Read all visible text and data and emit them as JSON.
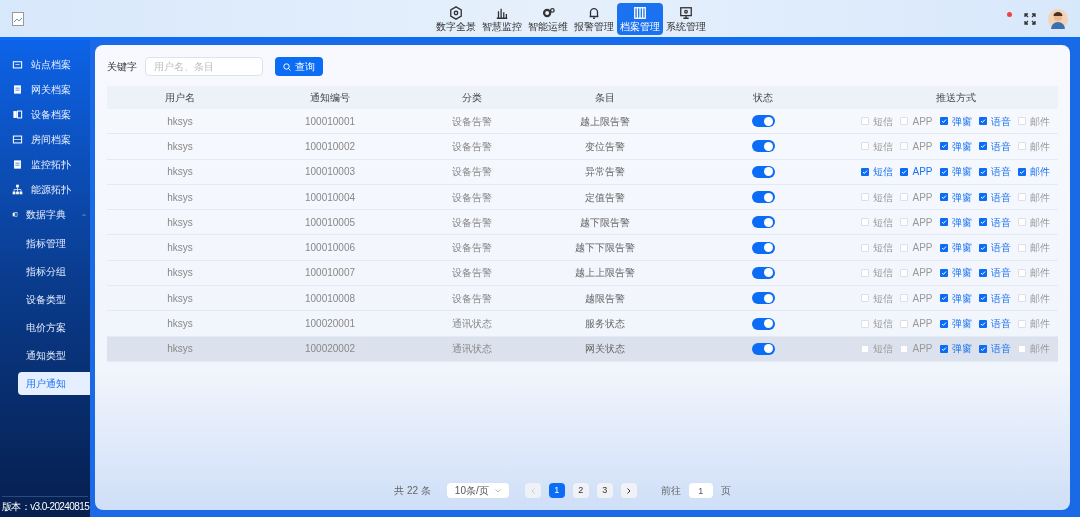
{
  "header": {
    "nav": [
      {
        "label": "数字全景",
        "selected": false
      },
      {
        "label": "智慧监控",
        "selected": false
      },
      {
        "label": "智能运维",
        "selected": false
      },
      {
        "label": "报警管理",
        "selected": false
      },
      {
        "label": "档案管理",
        "selected": true
      },
      {
        "label": "系统管理",
        "selected": false
      }
    ]
  },
  "sidebar": {
    "items": [
      {
        "label": "站点档案",
        "selected": false
      },
      {
        "label": "网关档案",
        "selected": false
      },
      {
        "label": "设备档案",
        "selected": false
      },
      {
        "label": "房间档案",
        "selected": false
      },
      {
        "label": "监控拓扑",
        "selected": false
      },
      {
        "label": "能源拓扑",
        "selected": false
      },
      {
        "label": "数据字典",
        "selected": false,
        "expanded": true,
        "children": [
          {
            "label": "指标管理",
            "selected": false
          },
          {
            "label": "指标分组",
            "selected": false
          },
          {
            "label": "设备类型",
            "selected": false
          },
          {
            "label": "电价方案",
            "selected": false
          },
          {
            "label": "通知类型",
            "selected": false
          },
          {
            "label": "用户通知",
            "selected": true
          }
        ]
      }
    ],
    "version": "版本：v3.0-20240815"
  },
  "search": {
    "label": "关键字",
    "placeholder": "用户名、条目",
    "button": "查询"
  },
  "table": {
    "columns": [
      "用户名",
      "通知编号",
      "分类",
      "条目",
      "状态",
      "推送方式"
    ],
    "rows": [
      {
        "user": "hksys",
        "id": "100010001",
        "category": "设备告警",
        "item": "越上限告警",
        "on": true,
        "selected": false,
        "channels": [
          {
            "label": "短信",
            "checked": false
          },
          {
            "label": "APP",
            "checked": false
          },
          {
            "label": "弹窗",
            "checked": true
          },
          {
            "label": "语音",
            "checked": true
          },
          {
            "label": "邮件",
            "checked": false
          }
        ]
      },
      {
        "user": "hksys",
        "id": "100010002",
        "category": "设备告警",
        "item": "变位告警",
        "on": true,
        "selected": false,
        "channels": [
          {
            "label": "短信",
            "checked": false
          },
          {
            "label": "APP",
            "checked": false
          },
          {
            "label": "弹窗",
            "checked": true
          },
          {
            "label": "语音",
            "checked": true
          },
          {
            "label": "邮件",
            "checked": false
          }
        ]
      },
      {
        "user": "hksys",
        "id": "100010003",
        "category": "设备告警",
        "item": "异常告警",
        "on": true,
        "selected": false,
        "channels": [
          {
            "label": "短信",
            "checked": true
          },
          {
            "label": "APP",
            "checked": true
          },
          {
            "label": "弹窗",
            "checked": true
          },
          {
            "label": "语音",
            "checked": true
          },
          {
            "label": "邮件",
            "checked": true
          }
        ]
      },
      {
        "user": "hksys",
        "id": "100010004",
        "category": "设备告警",
        "item": "定值告警",
        "on": true,
        "selected": false,
        "channels": [
          {
            "label": "短信",
            "checked": false
          },
          {
            "label": "APP",
            "checked": false
          },
          {
            "label": "弹窗",
            "checked": true
          },
          {
            "label": "语音",
            "checked": true
          },
          {
            "label": "邮件",
            "checked": false
          }
        ]
      },
      {
        "user": "hksys",
        "id": "100010005",
        "category": "设备告警",
        "item": "越下限告警",
        "on": true,
        "selected": false,
        "channels": [
          {
            "label": "短信",
            "checked": false
          },
          {
            "label": "APP",
            "checked": false
          },
          {
            "label": "弹窗",
            "checked": true
          },
          {
            "label": "语音",
            "checked": true
          },
          {
            "label": "邮件",
            "checked": false
          }
        ]
      },
      {
        "user": "hksys",
        "id": "100010006",
        "category": "设备告警",
        "item": "越下下限告警",
        "on": true,
        "selected": false,
        "channels": [
          {
            "label": "短信",
            "checked": false
          },
          {
            "label": "APP",
            "checked": false
          },
          {
            "label": "弹窗",
            "checked": true
          },
          {
            "label": "语音",
            "checked": true
          },
          {
            "label": "邮件",
            "checked": false
          }
        ]
      },
      {
        "user": "hksys",
        "id": "100010007",
        "category": "设备告警",
        "item": "越上上限告警",
        "on": true,
        "selected": false,
        "channels": [
          {
            "label": "短信",
            "checked": false
          },
          {
            "label": "APP",
            "checked": false
          },
          {
            "label": "弹窗",
            "checked": true
          },
          {
            "label": "语音",
            "checked": true
          },
          {
            "label": "邮件",
            "checked": false
          }
        ]
      },
      {
        "user": "hksys",
        "id": "100010008",
        "category": "设备告警",
        "item": "越限告警",
        "on": true,
        "selected": false,
        "channels": [
          {
            "label": "短信",
            "checked": false
          },
          {
            "label": "APP",
            "checked": false
          },
          {
            "label": "弹窗",
            "checked": true
          },
          {
            "label": "语音",
            "checked": true
          },
          {
            "label": "邮件",
            "checked": false
          }
        ]
      },
      {
        "user": "hksys",
        "id": "100020001",
        "category": "通讯状态",
        "item": "服务状态",
        "on": true,
        "selected": false,
        "channels": [
          {
            "label": "短信",
            "checked": false
          },
          {
            "label": "APP",
            "checked": false
          },
          {
            "label": "弹窗",
            "checked": true
          },
          {
            "label": "语音",
            "checked": true
          },
          {
            "label": "邮件",
            "checked": false
          }
        ]
      },
      {
        "user": "hksys",
        "id": "100020002",
        "category": "通讯状态",
        "item": "网关状态",
        "on": true,
        "selected": true,
        "channels": [
          {
            "label": "短信",
            "checked": false
          },
          {
            "label": "APP",
            "checked": false
          },
          {
            "label": "弹窗",
            "checked": true
          },
          {
            "label": "语音",
            "checked": true
          },
          {
            "label": "邮件",
            "checked": false
          }
        ]
      }
    ]
  },
  "pagination": {
    "total": "共 22 条",
    "page_size": "10条/页",
    "prev_disabled": true,
    "pages": [
      {
        "label": "1",
        "selected": true
      },
      {
        "label": "2",
        "selected": false
      },
      {
        "label": "3",
        "selected": false
      }
    ],
    "goto_label": "前往",
    "goto_value": "1",
    "goto_suffix": "页"
  }
}
